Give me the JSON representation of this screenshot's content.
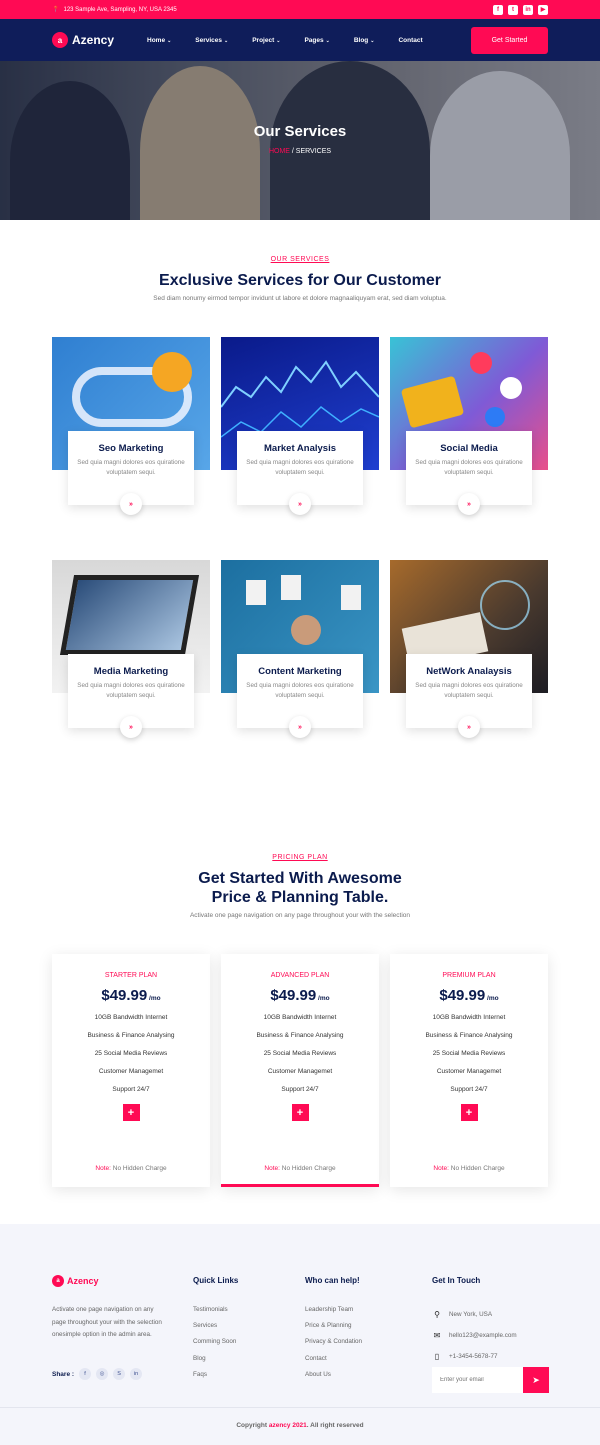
{
  "topbar": {
    "address": "123 Sample Ave, Sampling, NY, USA 2345",
    "social_icons": [
      "facebook-icon",
      "twitter-icon",
      "linkedin-icon",
      "youtube-icon"
    ],
    "social_glyphs": [
      "f",
      "t",
      "in",
      "▶"
    ]
  },
  "nav": {
    "logo_mark": "a",
    "logo_text": "Azency",
    "menu": [
      {
        "label": "Home",
        "chevron": true
      },
      {
        "label": "Services",
        "chevron": true
      },
      {
        "label": "Project",
        "chevron": true
      },
      {
        "label": "Pages",
        "chevron": true
      },
      {
        "label": "Blog",
        "chevron": true
      },
      {
        "label": "Contact",
        "chevron": false
      }
    ],
    "cta": "Get Started"
  },
  "hero": {
    "title": "Our Services",
    "breadcrumb_home": "HOME",
    "breadcrumb_sep": " / ",
    "breadcrumb_current": "SERVICES"
  },
  "services": {
    "tag": "OUR SERVICES",
    "title": "Exclusive Services for Our Customer",
    "description": "Sed diam nonumy eirmod tempor invidunt ut labore et dolore magnaaliquyam erat, sed diam voluptua.",
    "items": [
      {
        "title": "Seo Marketing",
        "text": "Sed quia magni dolores eos quiratione voluptatem sequi.",
        "arrow": "»"
      },
      {
        "title": "Market Analysis",
        "text": "Sed quia magni dolores eos quiratione voluptatem sequi.",
        "arrow": "»"
      },
      {
        "title": "Social Media",
        "text": "Sed quia magni dolores eos quiratione voluptatem sequi.",
        "arrow": "»"
      },
      {
        "title": "Media Marketing",
        "text": "Sed quia magni dolores eos quiratione voluptatem sequi.",
        "arrow": "»"
      },
      {
        "title": "Content Marketing",
        "text": "Sed quia magni dolores eos quiratione voluptatem sequi.",
        "arrow": "»"
      },
      {
        "title": "NetWork Analaysis",
        "text": "Sed quia magni dolores eos quiratione voluptatem sequi.",
        "arrow": "»"
      }
    ]
  },
  "pricing": {
    "tag": "PRICING PLAN",
    "title_line1": "Get Started With Awesome",
    "title_line2": "Price & Planning Table.",
    "description": "Activate one page navigation on any page throughout your with the selection",
    "plans": [
      {
        "name": "STARTER PLAN",
        "price": "$49.99",
        "per": " /mo",
        "features": [
          "10GB Bandwidth Internet",
          "Business & Finance Analysing",
          "25 Social Media Reviews",
          "Customer Managemet",
          "Support 24/7"
        ],
        "plus": "+",
        "note_label": "Note:",
        "note_text": " No Hidden Charge"
      },
      {
        "name": "ADVANCED PLAN",
        "price": "$49.99",
        "per": " /mo",
        "features": [
          "10GB Bandwidth Internet",
          "Business & Finance Analysing",
          "25 Social Media Reviews",
          "Customer Managemet",
          "Support 24/7"
        ],
        "plus": "+",
        "note_label": "Note:",
        "note_text": " No Hidden Charge"
      },
      {
        "name": "PREMIUM PLAN",
        "price": "$49.99",
        "per": " /mo",
        "features": [
          "10GB Bandwidth Internet",
          "Business & Finance Analysing",
          "25 Social Media Reviews",
          "Customer Managemet",
          "Support 24/7"
        ],
        "plus": "+",
        "note_label": "Note:",
        "note_text": " No Hidden Charge"
      }
    ]
  },
  "footer": {
    "logo_mark": "a",
    "logo_text": "Azency",
    "about": "Activate one page navigation on any page throughout your with the selection onesimple option in the admin area.",
    "share_label": "Share :",
    "share_icons": [
      {
        "name": "facebook-icon",
        "glyph": "f"
      },
      {
        "name": "pinterest-icon",
        "glyph": "◎"
      },
      {
        "name": "skype-icon",
        "glyph": "S"
      },
      {
        "name": "linkedin-icon",
        "glyph": "in"
      }
    ],
    "quick_links_title": "Quick Links",
    "quick_links": [
      "Testimonials",
      "Services",
      "Comming Soon",
      "Blog",
      "Faqs"
    ],
    "who_title": "Who can help!",
    "who_links": [
      "Leadership Team",
      "Price & Planning",
      "Privacy & Condation",
      "Contact",
      "About Us"
    ],
    "touch_title": "Get In Touch",
    "location": "New York, USA",
    "email": "hello123@example.com",
    "phone": "+1-3454-5678-77",
    "newsletter_placeholder": "Enter your email",
    "copyright_prefix": "Copyright ",
    "copyright_brand": "azency 2021",
    "copyright_suffix": ". All right reserved"
  }
}
